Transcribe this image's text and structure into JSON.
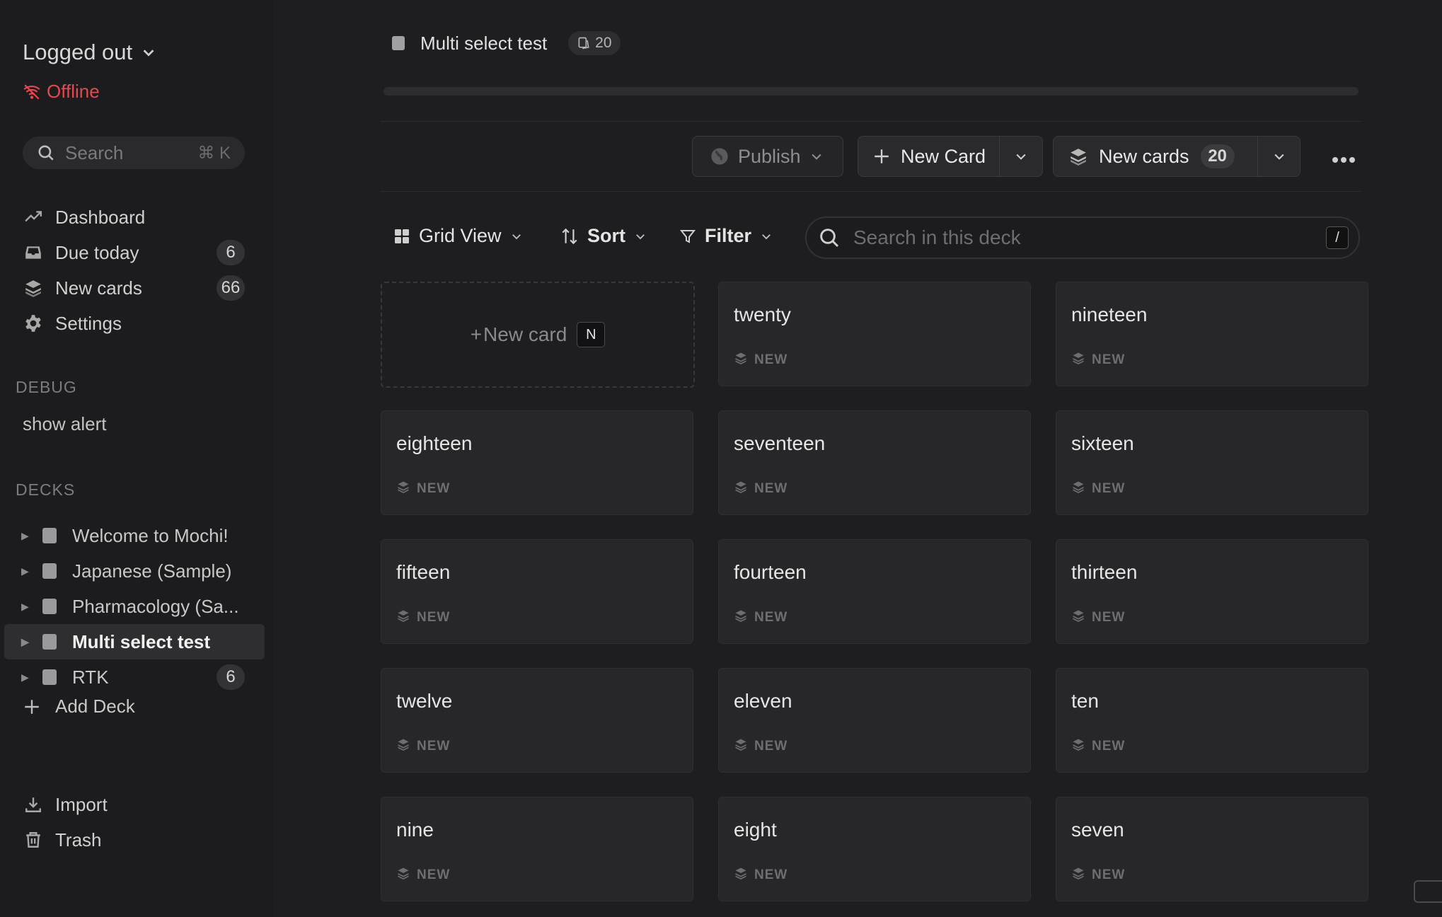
{
  "sidebar": {
    "account": {
      "name": "Logged out",
      "status": "Offline"
    },
    "search": {
      "placeholder": "Search",
      "shortcut": "⌘ K"
    },
    "nav": [
      {
        "label": "Dashboard",
        "icon": "trend-icon"
      },
      {
        "label": "Due today",
        "icon": "inbox-icon",
        "badge": "6"
      },
      {
        "label": "New cards",
        "icon": "layers-icon",
        "badge": "66"
      },
      {
        "label": "Settings",
        "icon": "gear-icon"
      }
    ],
    "debug_heading": "DEBUG",
    "debug_item": "show alert",
    "decks_heading": "DECKS",
    "decks": [
      {
        "label": "Welcome to Mochi!"
      },
      {
        "label": "Japanese (Sample)"
      },
      {
        "label": "Pharmacology (Sa..."
      },
      {
        "label": "Multi select test",
        "active": true
      },
      {
        "label": "RTK",
        "badge": "6"
      }
    ],
    "add_deck": "Add Deck",
    "bottom": [
      {
        "label": "Import",
        "icon": "download-icon"
      },
      {
        "label": "Trash",
        "icon": "trash-icon"
      }
    ]
  },
  "header": {
    "deck_title": "Multi select test",
    "card_count": "20"
  },
  "actions": {
    "publish": "Publish",
    "new_card": "New Card",
    "new_cards": "New cards",
    "new_cards_count": "20"
  },
  "toolbar": {
    "view": "Grid View",
    "sort": "Sort",
    "filter": "Filter",
    "search_placeholder": "Search in this deck",
    "search_shortcut": "/"
  },
  "grid": {
    "new_card_label": "New card",
    "new_card_shortcut": "N",
    "cards": [
      {
        "title": "twenty",
        "status": "NEW"
      },
      {
        "title": "nineteen",
        "status": "NEW"
      },
      {
        "title": "eighteen",
        "status": "NEW"
      },
      {
        "title": "seventeen",
        "status": "NEW"
      },
      {
        "title": "sixteen",
        "status": "NEW"
      },
      {
        "title": "fifteen",
        "status": "NEW"
      },
      {
        "title": "fourteen",
        "status": "NEW"
      },
      {
        "title": "thirteen",
        "status": "NEW"
      },
      {
        "title": "twelve",
        "status": "NEW"
      },
      {
        "title": "eleven",
        "status": "NEW"
      },
      {
        "title": "ten",
        "status": "NEW"
      },
      {
        "title": "nine",
        "status": "NEW"
      },
      {
        "title": "eight",
        "status": "NEW"
      },
      {
        "title": "seven",
        "status": "NEW"
      }
    ]
  },
  "colors": {
    "offline": "#e5484d",
    "background": "#1e1e20",
    "card": "#27272a"
  }
}
